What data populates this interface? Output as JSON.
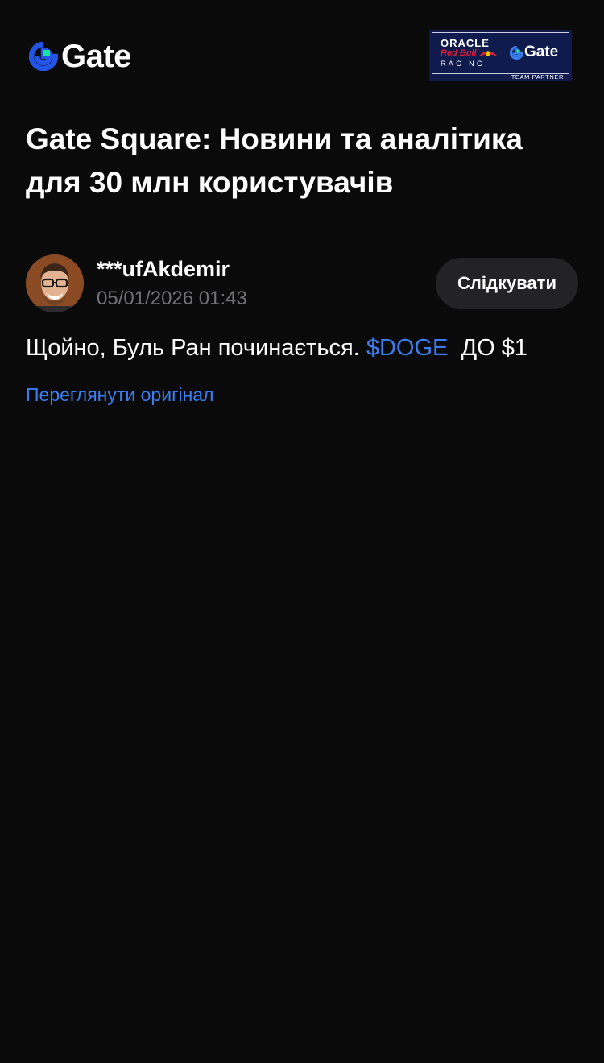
{
  "header": {
    "logo_text": "Gate",
    "logo_icon": "gate-logo-icon",
    "partner_badge": {
      "oracle": "ORACLE",
      "redbull": "Red Bull",
      "racing": "RACING",
      "gate_text": "Gate",
      "partner_label": "TEAM PARTNER"
    }
  },
  "page": {
    "title": "Gate Square: Новини та аналітика для 30 млн користувачів"
  },
  "post": {
    "author_name": "***ufAkdemir",
    "timestamp": "05/01/2026 01:43",
    "follow_label": "Слідкувати",
    "body_prefix": "Щойно, Буль Ран починається. ",
    "ticker": "$DOGE",
    "body_suffix": "  ДО $1",
    "view_original_label": "Переглянути оригінал"
  },
  "colors": {
    "background": "#0a0a0b",
    "accent_link": "#3a7ef2",
    "muted_text": "#727276",
    "button_bg": "#232325",
    "partner_bg": "#0f1b4d",
    "brand_blue": "#2354e6",
    "brand_green": "#17e6a1"
  }
}
